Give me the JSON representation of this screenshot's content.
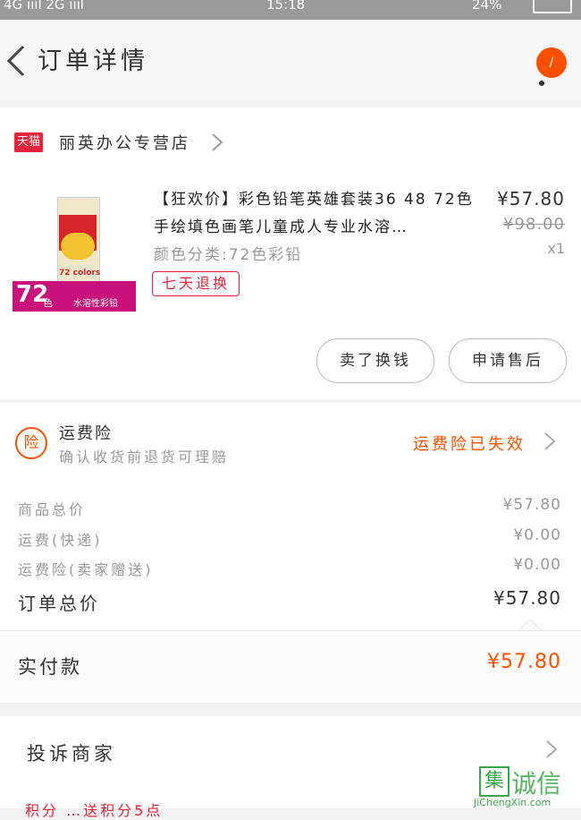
{
  "status_bar": {
    "network": "4G ıııl 2G ıııl",
    "time": "15:18",
    "battery": "24%"
  },
  "header": {
    "title": "订单详情",
    "badge": "/"
  },
  "store": {
    "platform_badge": "天猫",
    "name": "丽英办公专营店"
  },
  "product": {
    "name": "【狂欢价】彩色铅笔英雄套装36 48 72色手绘填色画笔儿童成人专业水溶…",
    "spec": "颜色分类:72色彩铅",
    "tag": "七天退换",
    "price": "¥57.80",
    "original_price": "¥98.00",
    "quantity": "x1",
    "thumb_count": "72",
    "thumb_unit": "色",
    "thumb_caption": "水溶性彩铅",
    "thumb_box_label": "72 colors"
  },
  "actions": {
    "review_button": "卖了换钱",
    "after_sale_button": "申请售后"
  },
  "insurance": {
    "icon_char": "险",
    "title": "运费险",
    "subtitle": "确认收货前退货可理赔",
    "status": "运费险已失效"
  },
  "summary": {
    "rows": [
      {
        "label": "商品总价",
        "value": "¥57.80"
      },
      {
        "label": "运费(快递)",
        "value": "¥0.00"
      },
      {
        "label": "运费险(卖家赠送)",
        "value": "¥0.00"
      }
    ],
    "total_label": "订单总价",
    "total_value": "¥57.80"
  },
  "payment": {
    "label": "实付款",
    "value": "¥57.80"
  },
  "complaint": {
    "label": "投诉商家"
  },
  "bottom_partial": "积分  …送积分5点",
  "watermark": {
    "char": "集",
    "text": "诚信",
    "url": "JiChengXin.com"
  },
  "colors": {
    "accent": "#ff5000",
    "tmall_red": "#e4243a",
    "background": "#f2f2f2"
  }
}
